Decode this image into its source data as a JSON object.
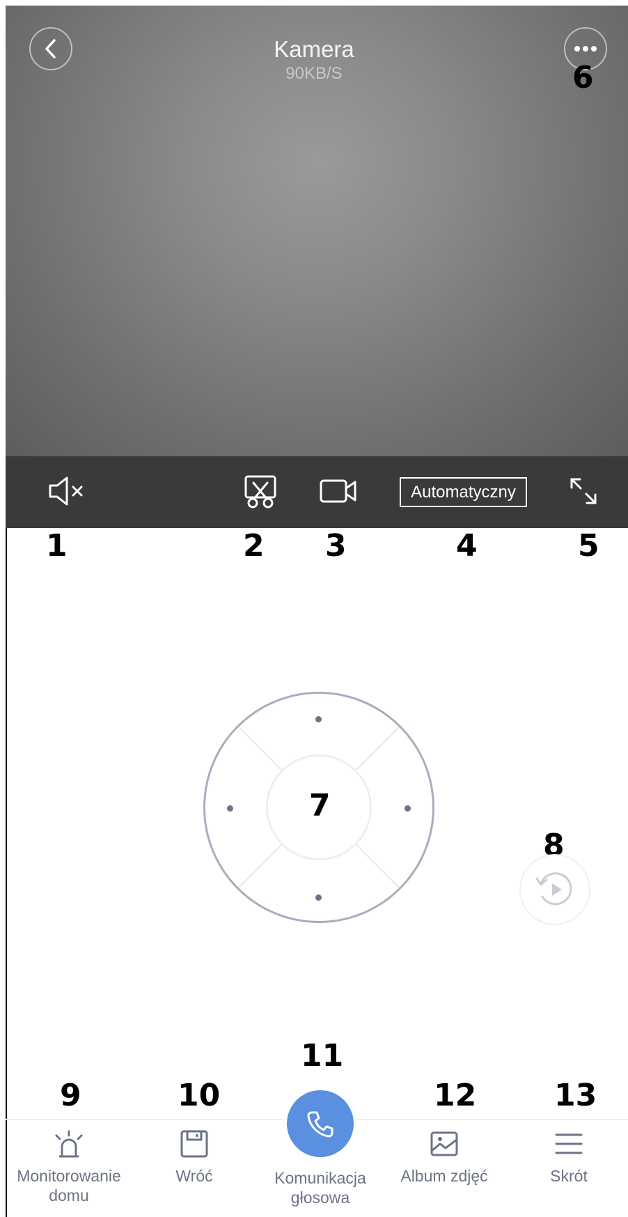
{
  "header": {
    "title": "Kamera",
    "speed": "90KB/S"
  },
  "toolbar": {
    "quality_label": "Automatyczny"
  },
  "markers": {
    "m1": "1",
    "m2": "2",
    "m3": "3",
    "m4": "4",
    "m5": "5",
    "m6": "6",
    "m7": "7",
    "m8": "8",
    "m9": "9",
    "m10": "10",
    "m11": "11",
    "m12": "12",
    "m13": "13"
  },
  "icons": {
    "back": "chevron-left-icon",
    "more": "more-dots-icon",
    "mute": "speaker-muted-icon",
    "screenshot": "scissors-icon",
    "record": "video-camera-icon",
    "fullscreen": "expand-icon",
    "replay": "replay-icon",
    "alarm": "alarm-siren-icon",
    "storage": "floppy-disk-icon",
    "call": "phone-icon",
    "album": "image-icon",
    "shortcut": "menu-icon"
  },
  "bottom_nav": {
    "home_monitoring_line1": "Monitorowanie",
    "home_monitoring_line2": "domu",
    "back_label": "Wróć",
    "voice_line1": "Komunikacja",
    "voice_line2": "głosowa",
    "album_label": "Album zdjęć",
    "shortcut_label": "Skrót"
  },
  "colors": {
    "accent": "#5b8fe0",
    "nav_text": "#6b7387",
    "ptz_ring": "#a9adbd"
  }
}
